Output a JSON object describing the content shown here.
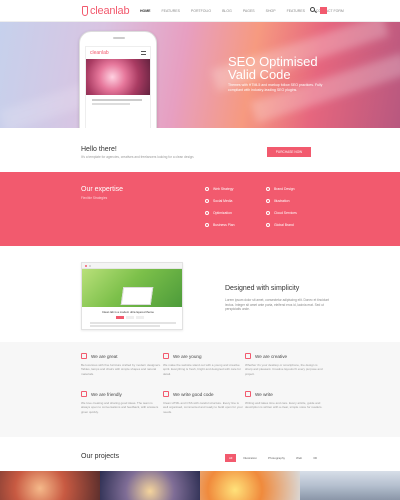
{
  "header": {
    "logo": "cleanlab",
    "nav": [
      "Home",
      "Features",
      "Portfolio",
      "Blog",
      "Pages",
      "Shop",
      "Features",
      "Contact Form"
    ],
    "active_index": 0
  },
  "hero": {
    "phone_logo": "cleanlab",
    "title_line1": "SEO Optimised",
    "title_line2": "Valid Code",
    "subtitle": "Themes with HTML5 and markup follow SEO practices. Fully compliant with industry-leading SEO plugins."
  },
  "hello": {
    "title": "Hello there!",
    "subtitle": "It's a template for agencies, creatives and freelancers looking for a clean design.",
    "button": "Purchase Now"
  },
  "expertise": {
    "title": "Our expertise",
    "subtitle": "Flexible Strategies",
    "items": [
      "Web Strategy",
      "Social Media",
      "Optimization",
      "Business Plan",
      "Brand Design",
      "Illustration",
      "Cloud Services",
      "Global Brand"
    ]
  },
  "simplicity": {
    "title": "Designed with simplicity",
    "text": "Lorem ipsum dolor sit amet, consectetur adipiscing elit. Donec et tincidunt lectus. Integer sit amet ante porta, eleifend eros id, lacinia erat. Sed ut perspiciatis unde.",
    "browser_caption": "Clean lab is a modern ultra layered theme"
  },
  "features": [
    {
      "title": "We are great",
      "text": "Be luxurious with fine furniture crafted by modern designers. Tables, lamps and chairs with simple shapes and natural materials."
    },
    {
      "title": "We are young",
      "text": "We make the website stand out with a young and creative spirit. Everything is fresh, bright and designed with care for detail."
    },
    {
      "title": "We are creative",
      "text": "Whether it's your desktop or smartphone, the design is sharp and pleasant. Creative layouts fit every purpose and project."
    },
    {
      "title": "We are friendly",
      "text": "We love creating and sharing good ideas. The team is always open to conversations and feedback, with answers given quickly."
    },
    {
      "title": "We write good code",
      "text": "Clean HTML and CSS with careful structure. Every line is well organised, commented and ready to build upon for your needs."
    },
    {
      "title": "We write",
      "text": "Writing well takes time and care. Every article, guide and description is written with a clear, simple voice for readers."
    }
  ],
  "projects": {
    "title": "Our projects",
    "filters": [
      "All",
      "Illustration",
      "Photography",
      "Web",
      "3D"
    ],
    "active_filter": 0
  },
  "colors": {
    "accent": "#f25a6e"
  }
}
